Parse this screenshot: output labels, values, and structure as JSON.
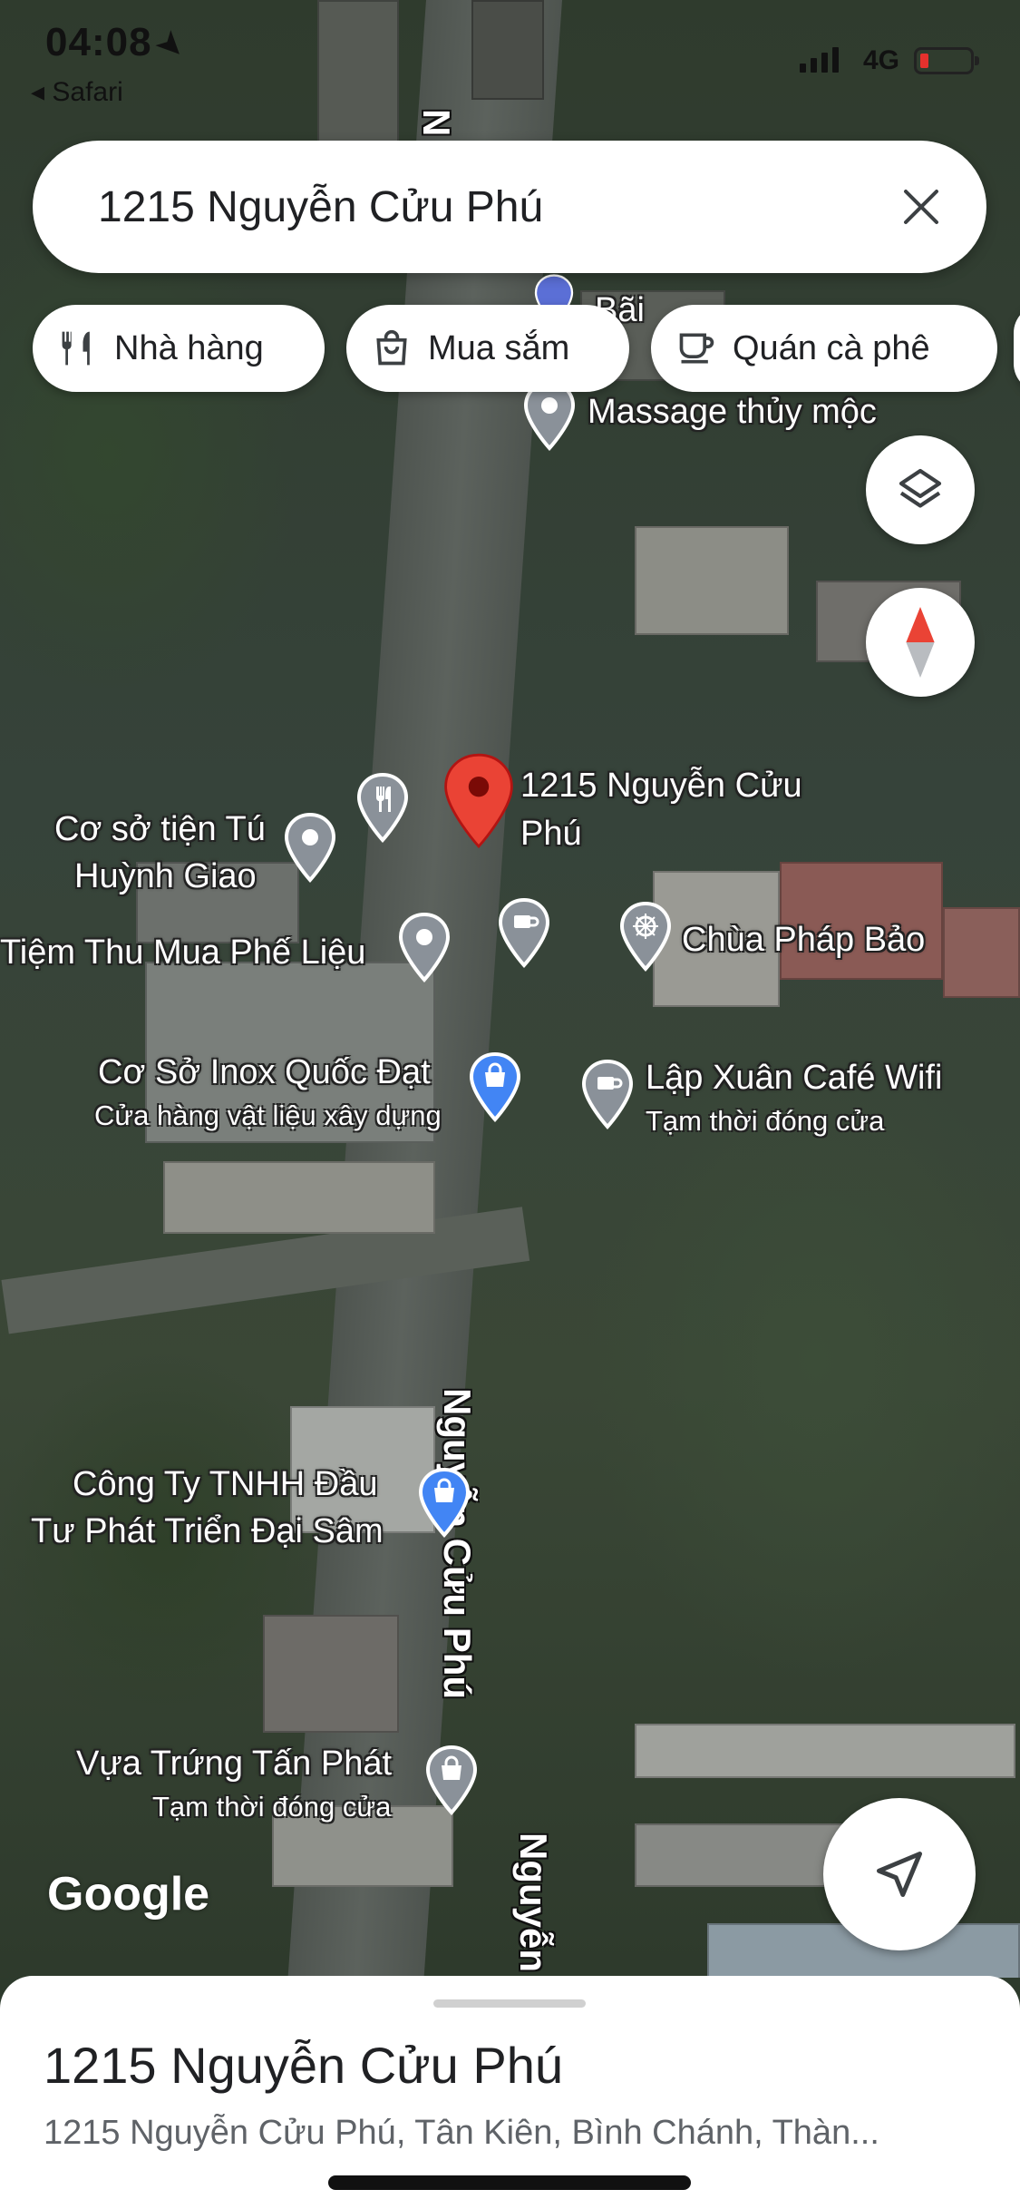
{
  "status_bar": {
    "time": "04:08",
    "back_label": "◂ Safari",
    "network": "4G"
  },
  "search": {
    "query": "1215 Nguyễn Cửu Phú"
  },
  "chips": [
    {
      "label": "Nhà hàng",
      "icon": "restaurant-icon"
    },
    {
      "label": "Mua sắm",
      "icon": "shopping-bag-icon"
    },
    {
      "label": "Quán cà phê",
      "icon": "coffee-icon"
    }
  ],
  "map": {
    "streets": [
      "N",
      "Nguyễn Cửu Phú",
      "Nguyễn Cửu Phú",
      "Nguyễn"
    ],
    "selected": {
      "line1": "1215 Nguyễn Cửu",
      "line2": "Phú",
      "color": "#ea4335"
    },
    "places": {
      "bai_partial": "Bãi",
      "massage": "Massage thủy mộc",
      "tien_tu_1": "Cơ sở tiện Tú",
      "tien_tu_2": "Huỳnh Giao",
      "phe_lieu": "Tiệm Thu Mua Phế Liệu",
      "chua": "Chùa Pháp Bảo",
      "inox": "Cơ Sở Inox Quốc Đạt",
      "inox_sub": "Cửa hàng vật liệu xây dựng",
      "lap_xuan": "Lập Xuân Café Wifi",
      "lap_xuan_sub": "Tạm thời đóng cửa",
      "cong_ty_1": "Công Ty TNHH Đầu",
      "cong_ty_2": "Tư Phát Triển Đại Sâm",
      "vua_trung": "Vựa Trứng Tấn Phát",
      "vua_trung_sub": "Tạm thời đóng cửa"
    },
    "pin_colors": {
      "gray": "#8a9199",
      "shop": "#4285f4",
      "brand": "#ea4335"
    },
    "logo": "Google"
  },
  "sheet": {
    "title": "1215 Nguyễn Cửu Phú",
    "address": "1215 Nguyễn Cửu Phú, Tân Kiên, Bình Chánh, Thàn..."
  }
}
